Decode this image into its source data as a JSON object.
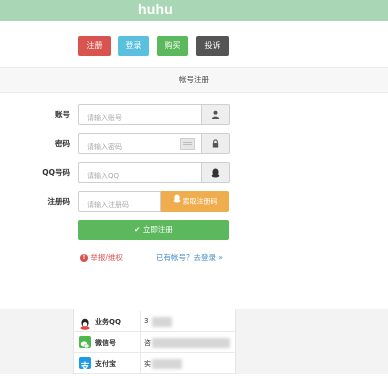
{
  "header": {
    "brand": "huhu",
    "bg_color": "#a9d7b6"
  },
  "nav": {
    "register": "注册",
    "login": "登录",
    "buy": "购买",
    "complaint": "投诉"
  },
  "section": {
    "title": "帐号注册"
  },
  "form": {
    "account": {
      "label": "账号",
      "placeholder": "请输入账号",
      "icon": "user-icon"
    },
    "password": {
      "label": "密码",
      "placeholder": "请输入密码",
      "icon": "lock-icon"
    },
    "qq": {
      "label": "QQ号码",
      "placeholder": "请输入QQ",
      "icon": "qq-penguin-icon"
    },
    "code": {
      "label": "注册码",
      "placeholder": "请输入注册码",
      "button": "索取注册码"
    },
    "submit": "立即注册"
  },
  "links": {
    "report": "举报/维权",
    "has_account": "已有帐号？去登录 »"
  },
  "contacts": [
    {
      "label": "业务QQ",
      "value": "3",
      "icon": "qq-icon"
    },
    {
      "label": "微信号",
      "value": "咨",
      "icon": "wechat-icon"
    },
    {
      "label": "支付宝",
      "value": "实",
      "icon": "alipay-icon"
    }
  ],
  "colors": {
    "red": "#d9534f",
    "blue": "#5bc0de",
    "green": "#5cb85c",
    "dark": "#555555",
    "orange": "#f0ad4e",
    "link": "#428bca"
  }
}
